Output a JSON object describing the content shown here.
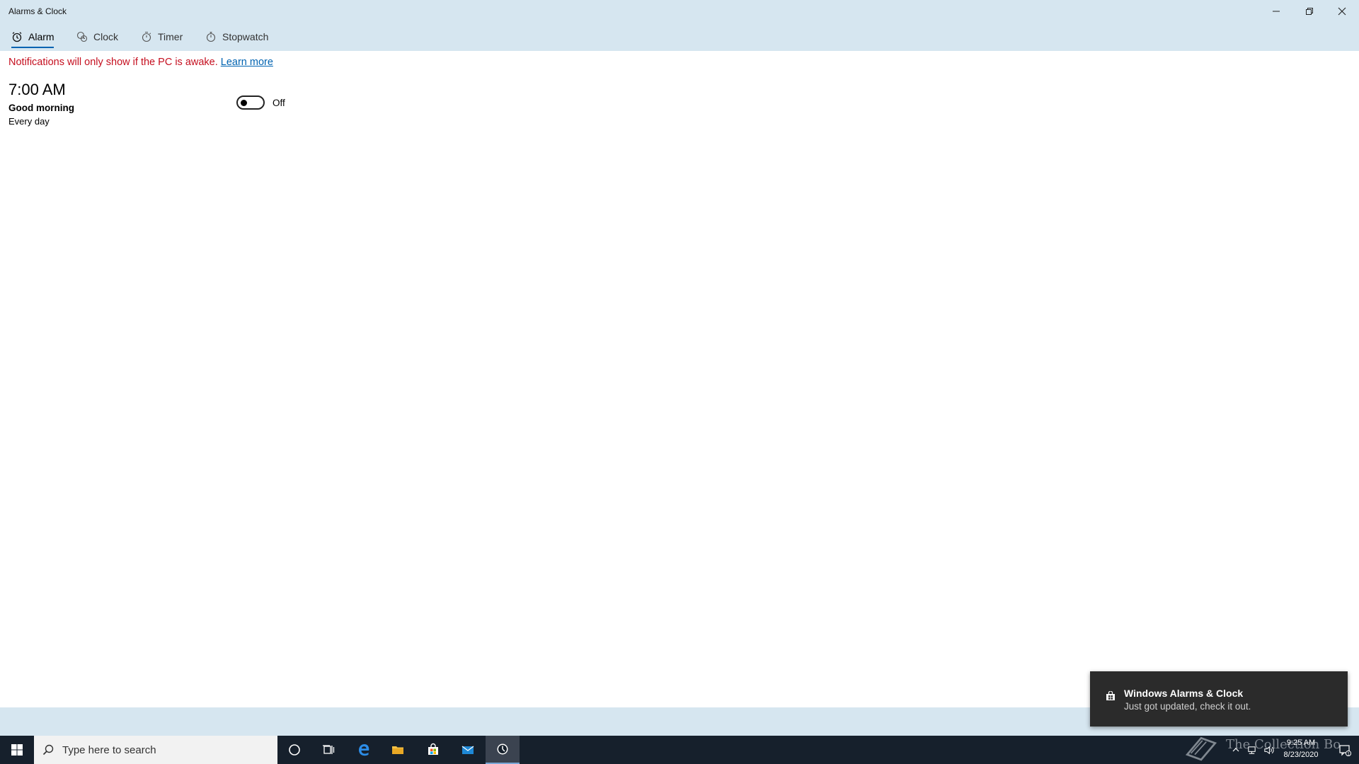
{
  "window": {
    "title": "Alarms & Clock",
    "controls": [
      "minimize-icon",
      "restore-icon",
      "close-icon"
    ]
  },
  "nav": {
    "tabs": [
      {
        "label": "Alarm",
        "icon": "alarm-icon",
        "active": true
      },
      {
        "label": "Clock",
        "icon": "world-clock-icon",
        "active": false
      },
      {
        "label": "Timer",
        "icon": "timer-icon",
        "active": false
      },
      {
        "label": "Stopwatch",
        "icon": "stopwatch-icon",
        "active": false
      }
    ]
  },
  "notice": {
    "text": "Notifications will only show if the PC is awake.",
    "link": "Learn more"
  },
  "alarms": [
    {
      "time": "7:00 AM",
      "name": "Good morning",
      "repeat": "Every day",
      "state_label": "Off",
      "on": false
    }
  ],
  "toast": {
    "title": "Windows Alarms & Clock",
    "body": "Just got updated, check it out.",
    "icon": "store-bag-icon"
  },
  "taskbar": {
    "search_placeholder": "Type here to search",
    "apps": [
      "cortana-icon",
      "task-view-icon",
      "edge-icon",
      "file-explorer-icon",
      "store-icon",
      "mail-icon",
      "alarms-clock-icon"
    ],
    "active_app": "alarms-clock-icon",
    "tray": {
      "time": "9:25 AM",
      "date": "8/23/2020",
      "notification_count": "1"
    },
    "watermark": "The Collection Bo"
  },
  "colors": {
    "accent": "#0063b1",
    "notice_red": "#c50f1f",
    "titlebar_bg": "#d6e6f0",
    "taskbar_bg": "#16202c",
    "toast_bg": "#2b2b2b"
  }
}
